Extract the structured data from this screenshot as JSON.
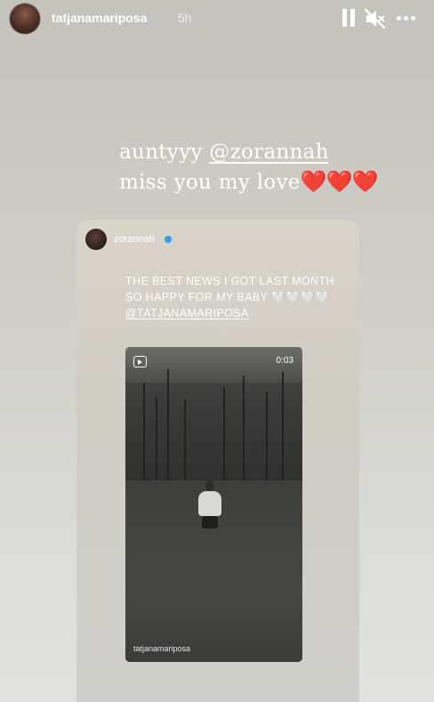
{
  "header": {
    "username": "tatjanamariposa",
    "time": "5h",
    "icons": [
      "avatar",
      "pause-icon",
      "muted-speaker-icon",
      "more-icon"
    ]
  },
  "caption": {
    "prefix": "auntyyy ",
    "mention": "@zorannah",
    "line2_text": "miss you my love",
    "hearts": "❤️❤️❤️"
  },
  "shared_story": {
    "username": "zorannah",
    "verified": true,
    "text_line1": "THE BEST NEWS I GOT LAST MONTH",
    "text_line2_prefix": "SO HAPPY FOR MY BABY ",
    "text_line2_hearts": "🤍🤍🤍🤍",
    "text_line3_mention": "@TATJANAMARIPOSA",
    "reel": {
      "duration": "0:03",
      "credit": "tatjanamariposa",
      "icon": "reels-icon"
    }
  },
  "colors": {
    "background_top": "#c4c2bc",
    "background_bottom": "#e2e3e0",
    "heart_red": "#d8262f",
    "verified_blue": "#3897f0"
  }
}
